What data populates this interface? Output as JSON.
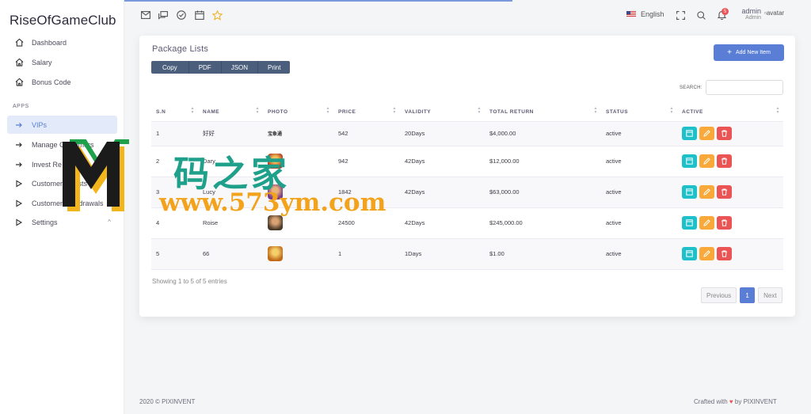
{
  "app": {
    "brand": "RiseOfGameClub"
  },
  "sidebar": {
    "items": [
      {
        "label": "Dashboard",
        "icon": "home-icon"
      },
      {
        "label": "Salary",
        "icon": "home-icon"
      },
      {
        "label": "Bonus Code",
        "icon": "home-icon"
      }
    ],
    "section_label": "APPS",
    "apps": [
      {
        "label": "VIPs",
        "icon": "arrow-right-icon",
        "active": true
      },
      {
        "label": "Manage Customers",
        "icon": "arrow-right-icon"
      },
      {
        "label": "Invest Re",
        "icon": "arrow-right-icon"
      },
      {
        "label": "Customer Invests",
        "icon": "play-icon"
      },
      {
        "label": "Customer Withdrawals",
        "icon": "play-icon"
      },
      {
        "label": "Settings",
        "icon": "play-icon",
        "chevron": "^"
      }
    ]
  },
  "topbar": {
    "language": "English",
    "notification_count": "5",
    "user_name": "admin",
    "user_role": "Admin",
    "avatar_alt": "avatar"
  },
  "card": {
    "title": "Package Lists",
    "export_buttons": [
      "Copy",
      "PDF",
      "JSON",
      "Print"
    ],
    "add_button": "Add New Item",
    "search_label": "SEARCH:",
    "search_value": "",
    "columns": [
      "S.N",
      "NAME",
      "PHOTO",
      "PRICE",
      "VALIDITY",
      "TOTAL RETURN",
      "STATUS",
      "ACTIVE"
    ],
    "rows": [
      {
        "sn": "1",
        "name": "好好",
        "photo": "宝象通",
        "price": "542",
        "validity": "20Days",
        "total": "$4,000.00",
        "status": "active"
      },
      {
        "sn": "2",
        "name": "Dary",
        "photo": "",
        "price": "942",
        "validity": "42Days",
        "total": "$12,000.00",
        "status": "active"
      },
      {
        "sn": "3",
        "name": "Lucy",
        "photo": "",
        "price": "1842",
        "validity": "42Days",
        "total": "$63,000.00",
        "status": "active"
      },
      {
        "sn": "4",
        "name": "Roise",
        "photo": "",
        "price": "24500",
        "validity": "42Days",
        "total": "$245,000.00",
        "status": "active"
      },
      {
        "sn": "5",
        "name": "66",
        "photo": "",
        "price": "1",
        "validity": "1Days",
        "total": "$1.00",
        "status": "active"
      }
    ],
    "showing": "Showing 1 to 5 of 5 entries",
    "pager": {
      "prev": "Previous",
      "current": "1",
      "next": "Next"
    }
  },
  "footer": {
    "left": "2020 © PIXINVENT",
    "right_prefix": "Crafted with",
    "right_suffix": "by PIXINVENT"
  },
  "watermark": {
    "chinese": "码之家",
    "url": "www.573ym.com"
  },
  "colors": {
    "primary": "#5a7ed6",
    "info": "#1ec0c9",
    "warning": "#f8a93a",
    "danger": "#ea5455"
  }
}
